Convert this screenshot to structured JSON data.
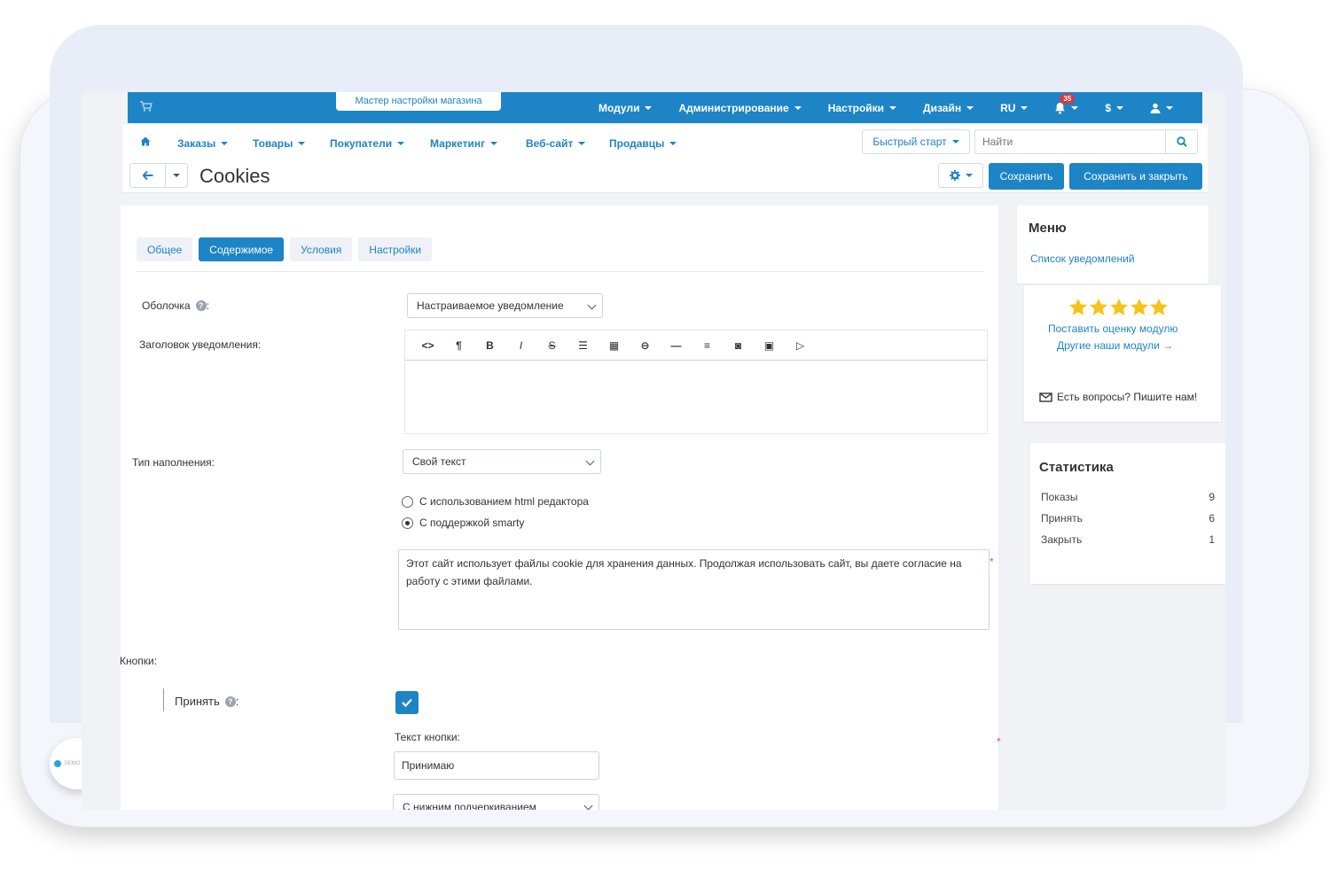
{
  "topbar": {
    "wizard_label": "Мастер настройки магазина",
    "items": [
      {
        "label": "Модули"
      },
      {
        "label": "Администрирование"
      },
      {
        "label": "Настройки"
      },
      {
        "label": "Дизайн"
      },
      {
        "label": "RU"
      }
    ],
    "notification_count": "35",
    "currency_label": "$"
  },
  "subnav": {
    "items": [
      {
        "label": "Заказы"
      },
      {
        "label": "Товары"
      },
      {
        "label": "Покупатели"
      },
      {
        "label": "Маркетинг"
      },
      {
        "label": "Веб-сайт"
      },
      {
        "label": "Продавцы"
      }
    ],
    "quick_start_label": "Быстрый старт",
    "search_placeholder": "Найти"
  },
  "titlebar": {
    "title": "Cookies",
    "save_label": "Сохранить",
    "save_close_label": "Сохранить и закрыть"
  },
  "tabs": [
    {
      "label": "Общее",
      "active": false
    },
    {
      "label": "Содержимое",
      "active": true
    },
    {
      "label": "Условия",
      "active": false
    },
    {
      "label": "Настройки",
      "active": false
    }
  ],
  "form": {
    "wrapper_label": "Оболочка",
    "wrapper_value": "Настраиваемое уведомление",
    "header_label": "Заголовок уведомления:",
    "editor_tools": [
      "code",
      "paragraph",
      "bold",
      "italic",
      "strikethrough",
      "unordered-list",
      "table",
      "link",
      "horizontal-rule",
      "align",
      "font-color",
      "image",
      "video"
    ],
    "fill_type_label": "Тип наполнения:",
    "fill_type_value": "Свой текст",
    "radio_html": "С использованием html редактора",
    "radio_smarty": "С поддержкой smarty",
    "radio_selected": "smarty",
    "content_text": "Этот сайт использует файлы cookie для хранения данных. Продолжая использовать сайт, вы даете согласие на работу с этими файлами.",
    "buttons_label": "Кнопки:",
    "accept_label": "Принять",
    "accept_checked": true,
    "button_text_label": "Текст кнопки:",
    "button_text_value": "Принимаю",
    "underline_value": "С нижним подчеркиванием"
  },
  "sidebar": {
    "menu_title": "Меню",
    "menu_link": "Список уведомлений",
    "rating_link": "Поставить оценку модулю",
    "other_link": "Другие наши модули →",
    "contact_label": "Есть вопросы? Пишите нам!",
    "stats_title": "Статистика",
    "stats": [
      {
        "label": "Показы",
        "value": "9"
      },
      {
        "label": "Принять",
        "value": "6"
      },
      {
        "label": "Закрыть",
        "value": "1"
      }
    ]
  },
  "device": {
    "logo_text": "DEMO STORE"
  },
  "colors": {
    "accent": "#1d84c6",
    "star": "#f5c419",
    "required": "#e05a47"
  }
}
